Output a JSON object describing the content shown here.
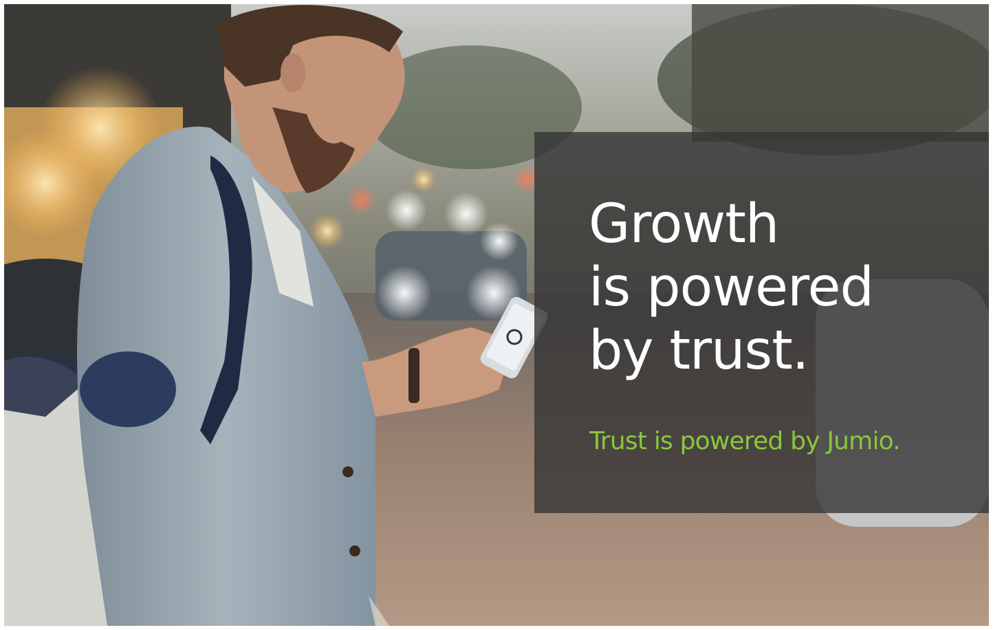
{
  "ad": {
    "headline": {
      "line1": "Growth",
      "line2": "is powered",
      "line3": "by trust."
    },
    "tagline": "Trust is powered by Jumio."
  },
  "colors": {
    "headline": "#ffffff",
    "tagline": "#8dc63f",
    "overlay": "#343434"
  }
}
